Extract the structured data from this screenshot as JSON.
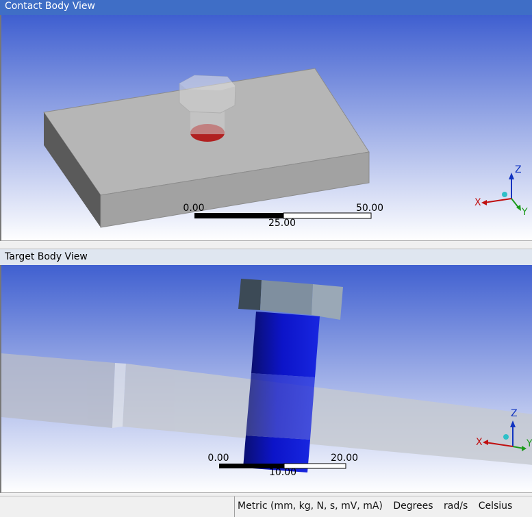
{
  "contact_view": {
    "title": "Contact Body View",
    "scale_left": "0.00",
    "scale_mid": "25.00",
    "scale_right": "50.00"
  },
  "target_view": {
    "title": "Target Body View",
    "scale_left": "0.00",
    "scale_mid": "10.00",
    "scale_right": "20.00"
  },
  "triad": {
    "x": "X",
    "y": "Y",
    "z": "Z"
  },
  "statusbar": {
    "units": "Metric (mm, kg, N, s, mV, mA)",
    "angle": "Degrees",
    "rotational": "rad/s",
    "temperature": "Celsius"
  },
  "colors": {
    "title_bar_active": "#3f6ec6",
    "title_bar_inactive": "#dfe6f0",
    "background_top": "#3f5fd0",
    "background_bottom": "#ffffff",
    "contact_highlight": "#b01010",
    "target_bolt": "#0c14c8"
  },
  "icons": [
    "triad-icon"
  ]
}
